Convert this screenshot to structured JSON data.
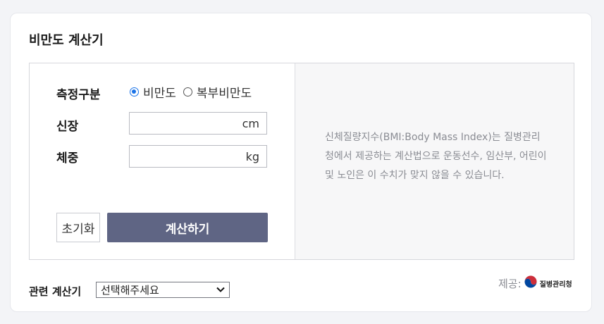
{
  "title": "비만도 계산기",
  "form": {
    "type_label": "측정구분",
    "options": [
      "비만도",
      "복부비만도"
    ],
    "selected": "비만도",
    "height_label": "신장",
    "height_unit": "cm",
    "height_value": "",
    "weight_label": "체중",
    "weight_unit": "kg",
    "weight_value": "",
    "reset_label": "초기화",
    "calc_label": "계산하기"
  },
  "description": "신체질량지수(BMI:Body Mass Index)는 질병관리청에서 제공하는 계산법으로 운동선수, 임산부, 어린이 및 노인은 이 수치가 맞지 않을 수 있습니다.",
  "related": {
    "label": "관련 계산기",
    "select_value": "선택해주세요"
  },
  "provider": {
    "label": "제공:",
    "logo_text": "질병관리청"
  },
  "colors": {
    "accent": "#1a73e8",
    "button": "#5f6584"
  }
}
